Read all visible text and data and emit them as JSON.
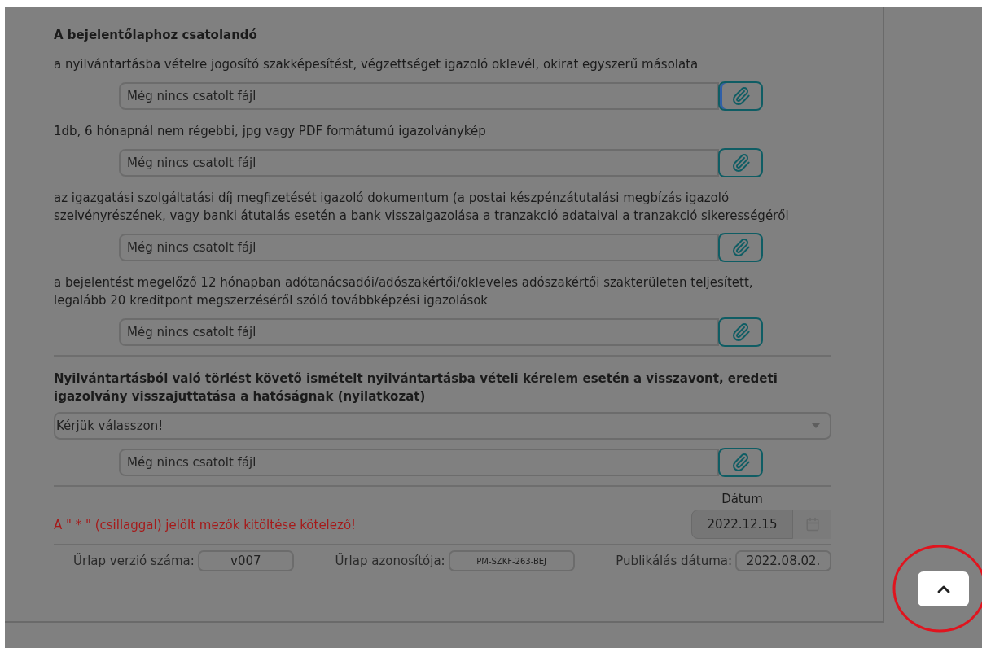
{
  "section_title": "A bejelentőlaphoz csatolandó",
  "attachments": [
    {
      "label": "a nyilvántartásba vételre jogosító szakképesítést, végzettséget igazoló oklevél, okirat egyszerű másolata",
      "field": "Még nincs csatolt fájl",
      "focused": true
    },
    {
      "label": "1db, 6 hónapnál nem régebbi, jpg vagy PDF formátumú igazolványkép",
      "field": "Még nincs csatolt fájl",
      "focused": false
    },
    {
      "label": "az igazgatási szolgáltatási díj megfizetését igazoló dokumentum (a postai készpénzátutalási megbízás igazoló szelvényrészének, vagy banki átutalás esetén a bank visszaigazolása a tranzakció adataival a tranzakció sikerességéről",
      "field": "Még nincs csatolt fájl",
      "focused": false
    },
    {
      "label": "a bejelentést megelőző 12 hónapban adótanácsadói/adószakértői/okleveles adószakértői szakterületen teljesített, legalább 20 kreditpont megszerzéséről szóló továbbképzési igazolások",
      "field": "Még nincs csatolt fájl",
      "focused": false
    }
  ],
  "declaration": {
    "title": "Nyilvántartásból való törlést követő ismételt nyilvántartásba vételi kérelem esetén a visszavont, eredeti igazolvány visszajuttatása a hatóságnak (nyilatkozat)",
    "select": {
      "value": "Kérjük válasszon!"
    },
    "attachment": {
      "field": "Még nincs csatolt fájl",
      "focused": false
    }
  },
  "required_note": "A \" * \" (csillaggal) jelölt mezők kitöltése kötelező!",
  "date": {
    "label": "Dátum",
    "value": "2022.12.15"
  },
  "footer": [
    {
      "label": "Űrlap verzió száma:",
      "value": "v007",
      "kind": "normal"
    },
    {
      "label": "Űrlap azonosítója:",
      "value": "PM-SZKF-263-BEJ",
      "kind": "small"
    },
    {
      "label": "Publikálás dátuma:",
      "value": "2022.08.02.",
      "kind": "normal"
    }
  ],
  "scroll_top_button": {
    "highlighted": true
  }
}
